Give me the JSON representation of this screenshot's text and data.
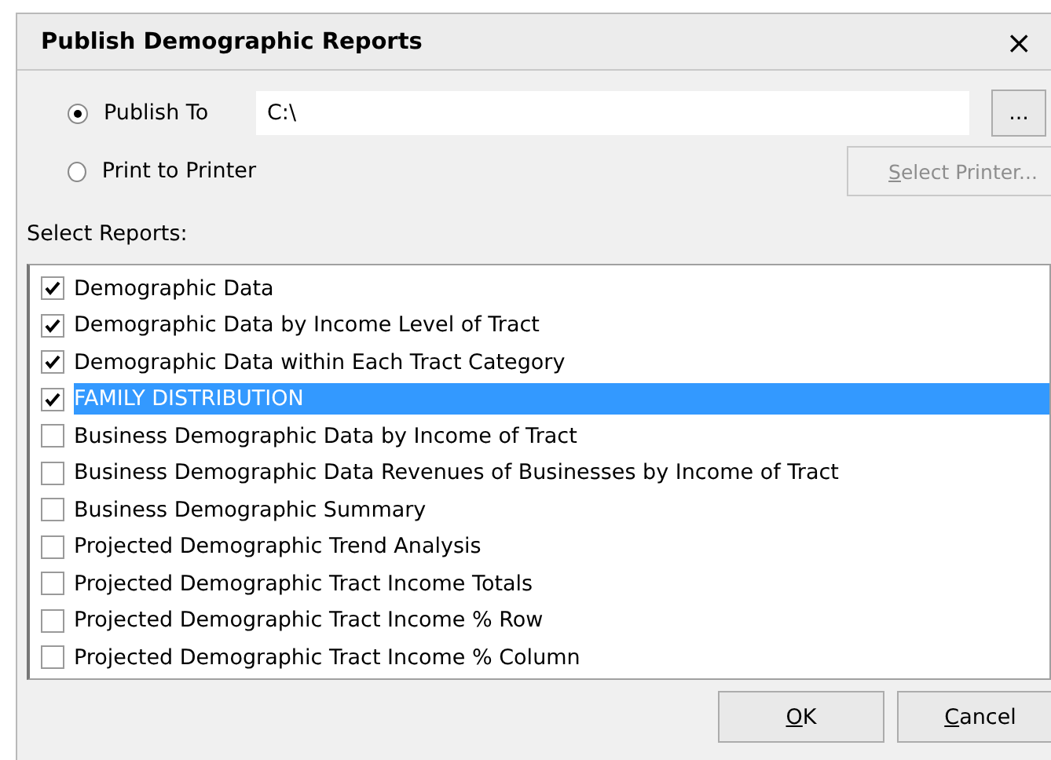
{
  "window": {
    "title": "Publish Demographic Reports",
    "close": "×"
  },
  "output": {
    "options": [
      {
        "label": "Publish To",
        "selected": true
      },
      {
        "label": "Print to Printer",
        "selected": false
      }
    ],
    "path": {
      "value": "C:\\"
    },
    "browse_button": {
      "label": "..."
    },
    "printer_button": {
      "label": "Select Printer...",
      "disabled": true,
      "access_key": true
    }
  },
  "reports": {
    "label": "Select Reports:",
    "items": [
      {
        "label": "Demographic Data",
        "checked": true,
        "selected": false
      },
      {
        "label": "Demographic Data by Income Level of Tract",
        "checked": true,
        "selected": false
      },
      {
        "label": "Demographic Data within Each Tract Category",
        "checked": true,
        "selected": false
      },
      {
        "label": "FAMILY DISTRIBUTION",
        "checked": true,
        "selected": true
      },
      {
        "label": "Business Demographic Data by Income of Tract",
        "checked": false,
        "selected": false
      },
      {
        "label": "Business Demographic Data Revenues of Businesses by Income of Tract",
        "checked": false,
        "selected": false
      },
      {
        "label": "Business Demographic Summary",
        "checked": false,
        "selected": false
      },
      {
        "label": "Projected Demographic Trend Analysis",
        "checked": false,
        "selected": false
      },
      {
        "label": "Projected Demographic Tract Income Totals",
        "checked": false,
        "selected": false
      },
      {
        "label": "Projected Demographic Tract Income % Row",
        "checked": false,
        "selected": false
      },
      {
        "label": "Projected Demographic Tract Income % Column",
        "checked": false,
        "selected": false
      }
    ]
  },
  "buttons": [
    {
      "label": "OK",
      "access_key": true
    },
    {
      "label": "Cancel",
      "access_key": true
    }
  ]
}
